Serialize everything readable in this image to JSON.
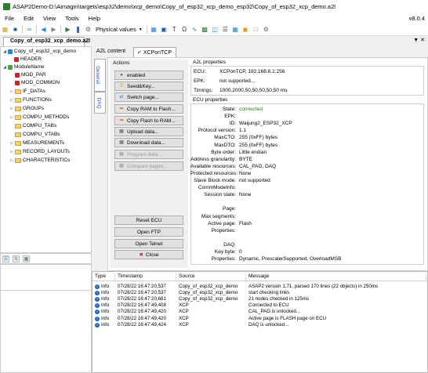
{
  "window": {
    "title": "ASAP2Demo-D:\\Aimagin\\targets\\esp32\\demo\\xcp_demo\\Copy_of_esp32_xcp_demo_esp32\\Copy_of_esp32_xcp_demo.a2l",
    "version": "v8.0.4"
  },
  "menu": [
    "File",
    "Edit",
    "View",
    "Tools",
    "Help"
  ],
  "toolbar": {
    "physical_values": "Physical values"
  },
  "doc_tab": "Copy_of_esp32_xcp_demo.a2l",
  "tree": [
    {
      "label": "Copy_of_esp32_xcp_demo",
      "kind": "root"
    },
    {
      "label": "HEADER",
      "kind": "leaf"
    },
    {
      "label": "ModuleName",
      "kind": "module"
    },
    {
      "label": "MOD_PAR",
      "kind": "leaf"
    },
    {
      "label": "MOD_COMMON",
      "kind": "leaf"
    },
    {
      "label": "IF_DATAs",
      "kind": "folder"
    },
    {
      "label": "FUNCTIONs",
      "kind": "folder"
    },
    {
      "label": "GROUPs",
      "kind": "folder"
    },
    {
      "label": "COMPU_METHODs",
      "kind": "folder"
    },
    {
      "label": "COMPU_TABs",
      "kind": "folder"
    },
    {
      "label": "COMPU_VTABs",
      "kind": "folder"
    },
    {
      "label": "MEASUREMENTs",
      "kind": "folder"
    },
    {
      "label": "RECORD_LAYOUTs",
      "kind": "folder"
    },
    {
      "label": "CHARACTERISTICs",
      "kind": "folder"
    }
  ],
  "content_tabs": [
    "A2L content",
    "XCPonTCP"
  ],
  "side_tabs": [
    "General",
    "DAQ"
  ],
  "actions": {
    "title": "Actions",
    "buttons": [
      "enabled",
      "Seed&Key...",
      "Switch page...",
      "Copy RAM to Flash...",
      "Copy Flash to RAM...",
      "Upload data...",
      "Download data...",
      "Program data...",
      "Compare pages..."
    ],
    "bottom_buttons": [
      "Reset ECU",
      "Open FTP",
      "Open Telnet",
      "Close"
    ]
  },
  "a2l_properties": {
    "title": "A2L properties",
    "rows": [
      {
        "k": "ECU:",
        "v": "XCPonTCP, 192.168.8.1:256"
      },
      {
        "k": "EPK:",
        "v": "not supported..."
      },
      {
        "k": "Timings:",
        "v": "1000,2000,50,50,50,50,50 ms"
      }
    ]
  },
  "ecu_properties": {
    "title": "ECU properties",
    "rows": [
      {
        "k": "State:",
        "v": "connected"
      },
      {
        "k": "EPK:",
        "v": ""
      },
      {
        "k": "ID:",
        "v": "Waijung2_ESP32_XCP"
      },
      {
        "k": "Protocol version:",
        "v": "1.1"
      },
      {
        "k": "MaxCTO:",
        "v": "255 (0xFF) bytes"
      },
      {
        "k": "MaxDTO:",
        "v": "255 (0xFF) bytes"
      },
      {
        "k": "Byte order:",
        "v": "Little endian"
      },
      {
        "k": "Address granularity:",
        "v": "BYTE"
      },
      {
        "k": "Available resources:",
        "v": "CAL_PAG, DAQ"
      },
      {
        "k": "Protected resources:",
        "v": "None"
      },
      {
        "k": "Slave Block mode:",
        "v": "not supported"
      },
      {
        "k": "CommModeInfo:",
        "v": ""
      },
      {
        "k": "Session state:",
        "v": "None"
      },
      {
        "k": "",
        "v": ""
      },
      {
        "k": "Page:",
        "v": ""
      },
      {
        "k": "Max segments:",
        "v": ""
      },
      {
        "k": "Active page:",
        "v": "Flash"
      },
      {
        "k": "Properties:",
        "v": ""
      },
      {
        "k": "",
        "v": ""
      },
      {
        "k": "DAQ:",
        "v": ""
      },
      {
        "k": "Key byte:",
        "v": "0"
      },
      {
        "k": "Properties:",
        "v": "Dynamic, PrescalerSupported, OverloadMSB"
      }
    ]
  },
  "log": {
    "headers": [
      "Type",
      "Timestamp",
      "Source",
      "Message"
    ],
    "rows": [
      {
        "type": "Info",
        "time": "07/28/22 16:47:20,537",
        "source": "Copy_of_esp32_xcp_demo",
        "message": "ASAP2 version 1.71, parsed 170 lines (22 objects) in 250ms"
      },
      {
        "type": "Info",
        "time": "07/28/22 16:47:20,537",
        "source": "Copy_of_esp32_xcp_demo",
        "message": "start checking links"
      },
      {
        "type": "Info",
        "time": "07/28/22 16:47:20,681",
        "source": "Copy_of_esp32_xcp_demo",
        "message": "21 nodes checked in 125ms"
      },
      {
        "type": "Info",
        "time": "07/28/22 16:47:49,408",
        "source": "XCP",
        "message": "Connected to ECU"
      },
      {
        "type": "Info",
        "time": "07/28/22 16:47:49,420",
        "source": "XCP",
        "message": "CAL_PAG is unlocked..."
      },
      {
        "type": "Info",
        "time": "07/28/22 16:47:49,420",
        "source": "XCP",
        "message": "Active page is FLASH page on ECU"
      },
      {
        "type": "Info",
        "time": "07/28/22 16:47:49,424",
        "source": "XCP",
        "message": "DAQ is unlocked..."
      }
    ]
  }
}
